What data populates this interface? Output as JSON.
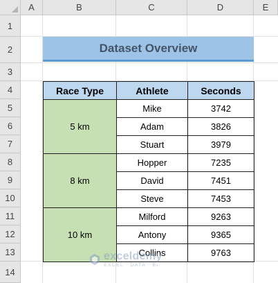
{
  "spreadsheet": {
    "columns": [
      "A",
      "B",
      "C",
      "D",
      "E"
    ],
    "rows": [
      "1",
      "2",
      "3",
      "4",
      "5",
      "6",
      "7",
      "8",
      "9",
      "10",
      "11",
      "12",
      "13",
      "14"
    ]
  },
  "title": "Dataset Overview",
  "table": {
    "headers": [
      "Race Type",
      "Athlete",
      "Seconds"
    ],
    "groups": [
      {
        "race_type": "5 km",
        "rows": [
          {
            "athlete": "Mike",
            "seconds": "3742"
          },
          {
            "athlete": "Adam",
            "seconds": "3826"
          },
          {
            "athlete": "Stuart",
            "seconds": "3979"
          }
        ]
      },
      {
        "race_type": "8 km",
        "rows": [
          {
            "athlete": "Hopper",
            "seconds": "7235"
          },
          {
            "athlete": "David",
            "seconds": "7451"
          },
          {
            "athlete": "Steve",
            "seconds": "7453"
          }
        ]
      },
      {
        "race_type": "10 km",
        "rows": [
          {
            "athlete": "Milford",
            "seconds": "9263"
          },
          {
            "athlete": "Antony",
            "seconds": "9365"
          },
          {
            "athlete": "Collins",
            "seconds": "9763"
          }
        ]
      }
    ]
  },
  "watermark": {
    "name": "exceldemy",
    "tagline": "EXCEL · DATA · BI"
  },
  "colors": {
    "header_fill": "#bdd7ee",
    "race_fill": "#c6e0b4",
    "title_fill": "#9dc3e6",
    "title_border": "#5b9bd5",
    "title_text": "#44546a"
  }
}
